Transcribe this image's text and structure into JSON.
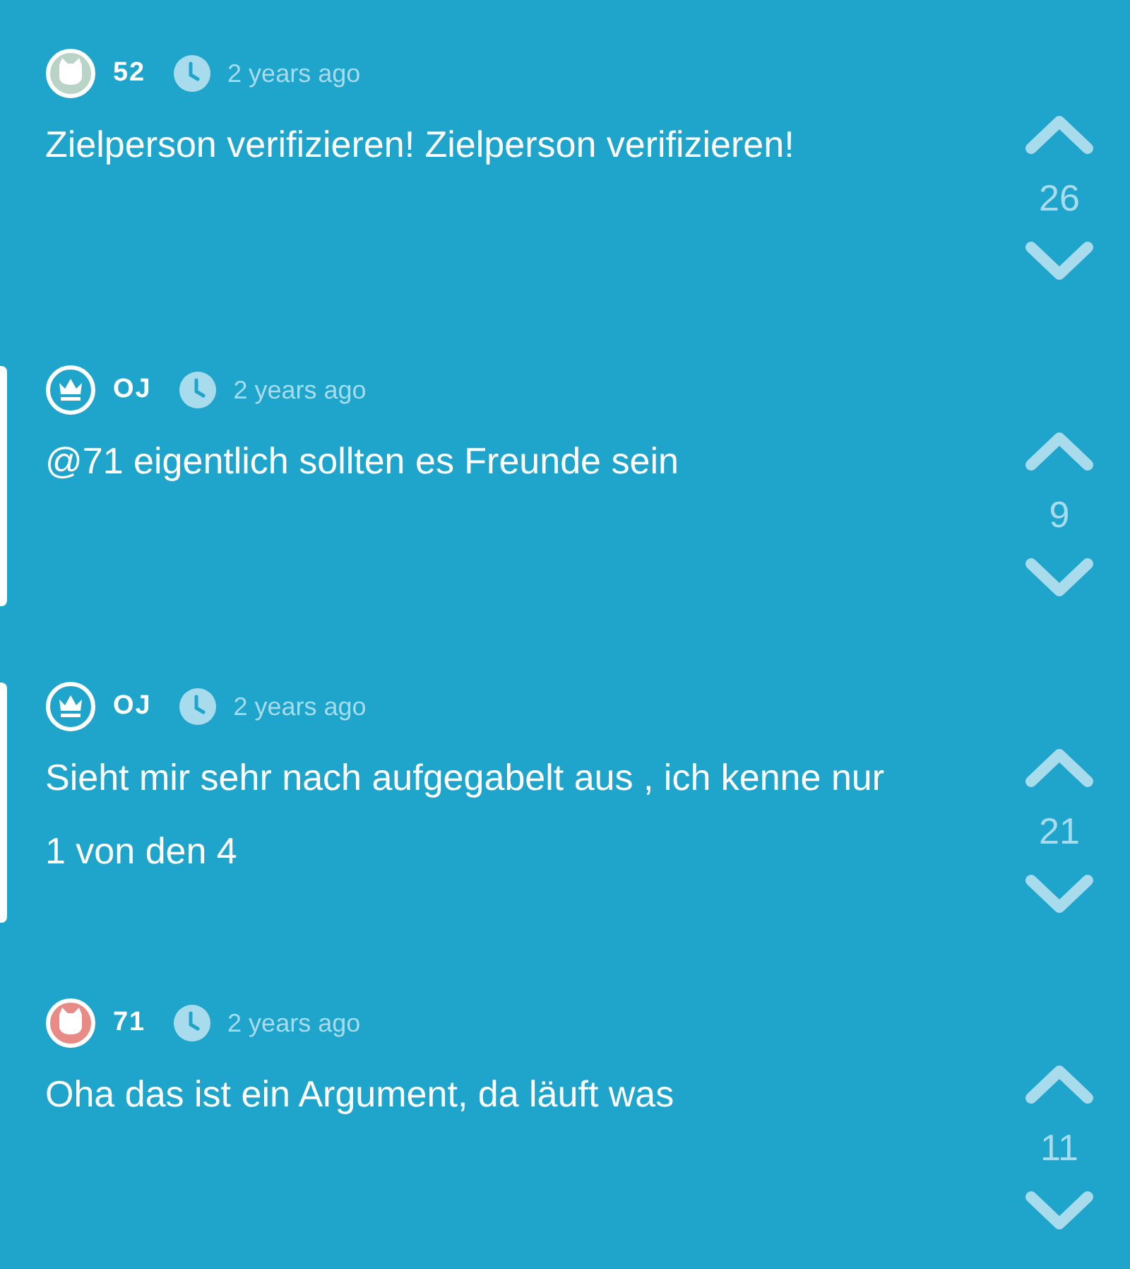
{
  "comments": [
    {
      "avatar": {
        "kind": "animal",
        "color": "#b9d3c6"
      },
      "author": "52",
      "time": "2 years ago",
      "text": "Zielperson verifizieren! Zielperson verifizieren!",
      "highlighted": false,
      "votes": "26"
    },
    {
      "avatar": {
        "kind": "op"
      },
      "author": "OJ",
      "time": "2 years ago",
      "text": "@71 eigentlich sollten es Freunde sein",
      "highlighted": true,
      "votes": "9"
    },
    {
      "avatar": {
        "kind": "op"
      },
      "author": "OJ",
      "time": "2 years ago",
      "text": "Sieht mir sehr nach aufgegabelt aus , ich kenne nur 1 von den 4",
      "highlighted": true,
      "votes": "21"
    },
    {
      "avatar": {
        "kind": "animal",
        "color": "#e88a86"
      },
      "author": "71",
      "time": "2 years ago",
      "text": "Oha das ist ein Argument, da läuft was",
      "highlighted": false,
      "votes": "11"
    }
  ]
}
